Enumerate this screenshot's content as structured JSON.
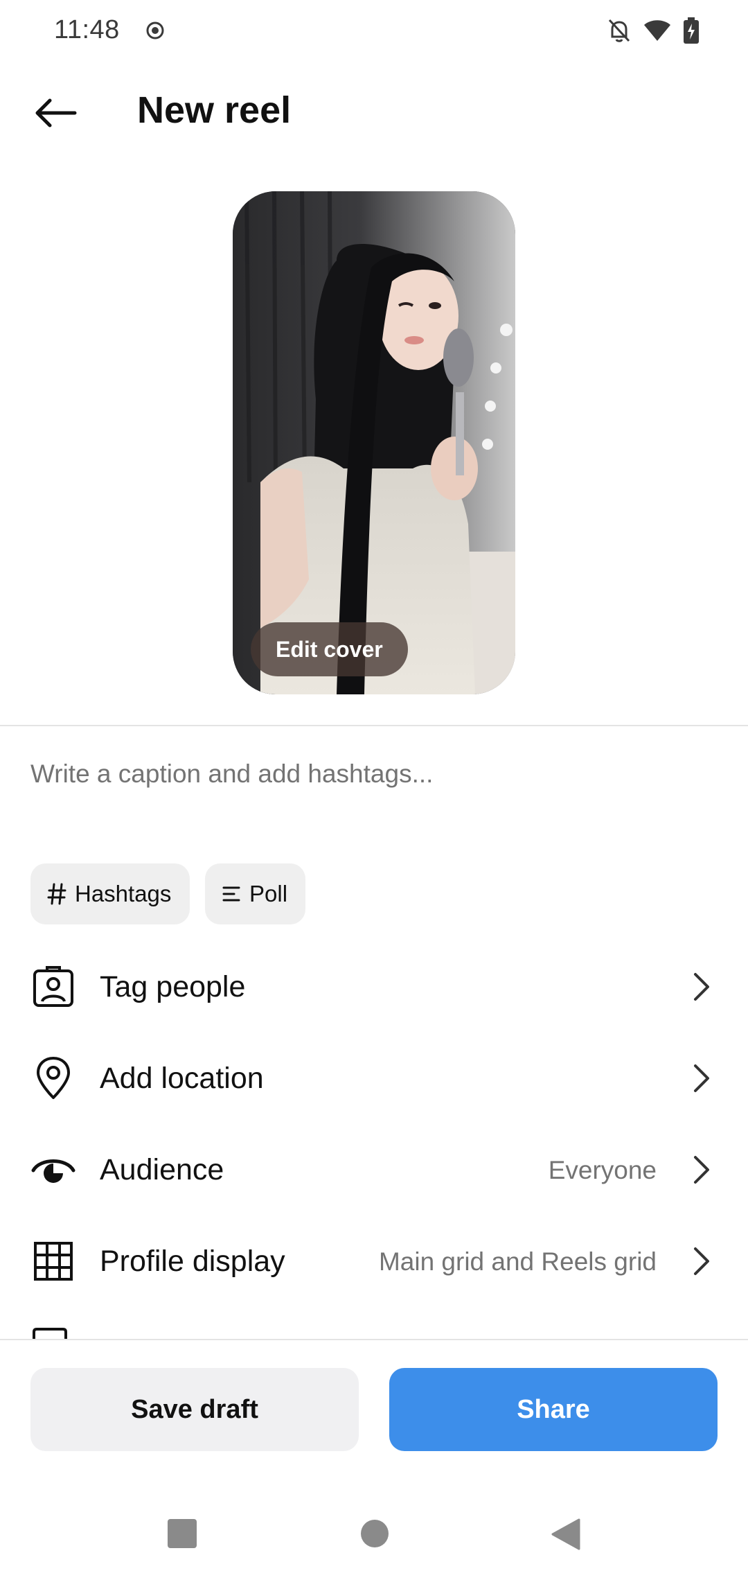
{
  "status_bar": {
    "time": "11:48",
    "icons": [
      "screen-record-icon",
      "bell-off-icon",
      "wifi-icon",
      "battery-charging-icon"
    ]
  },
  "header": {
    "title": "New reel",
    "back_icon": "arrow-left-icon"
  },
  "cover": {
    "edit_label": "Edit cover"
  },
  "caption": {
    "placeholder": "Write a caption and add hashtags..."
  },
  "chips": [
    {
      "label": "Hashtags",
      "icon": "hash-icon"
    },
    {
      "label": "Poll",
      "icon": "poll-icon"
    }
  ],
  "options": [
    {
      "label": "Tag people",
      "value": "",
      "icon": "tag-person-icon"
    },
    {
      "label": "Add location",
      "value": "",
      "icon": "location-pin-icon"
    },
    {
      "label": "Audience",
      "value": "Everyone",
      "icon": "audience-eye-icon"
    },
    {
      "label": "Profile display",
      "value": "Main grid and Reels grid",
      "icon": "grid-icon"
    }
  ],
  "actions": {
    "save_draft": "Save draft",
    "share": "Share"
  },
  "colors": {
    "accent": "#3d8eea",
    "secondary_text": "#737373",
    "chip_bg": "#efefef"
  }
}
